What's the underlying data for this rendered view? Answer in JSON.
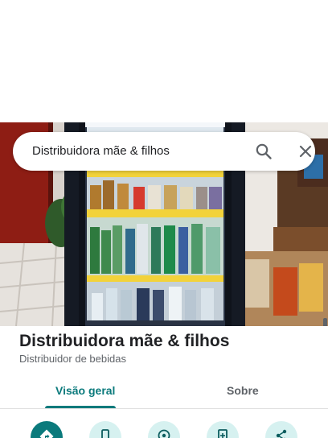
{
  "search": {
    "query": "Distribuidora mãe & filhos"
  },
  "place": {
    "name": "Distribuidora mãe & filhos",
    "category": "Distribuidor de bebidas"
  },
  "tabs": [
    {
      "label": "Visão geral",
      "active": true
    },
    {
      "label": "Sobre",
      "active": false
    }
  ],
  "actions": [
    {
      "icon": "directions-icon"
    },
    {
      "icon": "phone-icon"
    },
    {
      "icon": "location-icon"
    },
    {
      "icon": "save-icon"
    },
    {
      "icon": "share-icon"
    }
  ],
  "colors": {
    "accent": "#0b7a7c",
    "accent_light": "#d6f1f0",
    "text": "#202124",
    "muted": "#5f6368"
  }
}
